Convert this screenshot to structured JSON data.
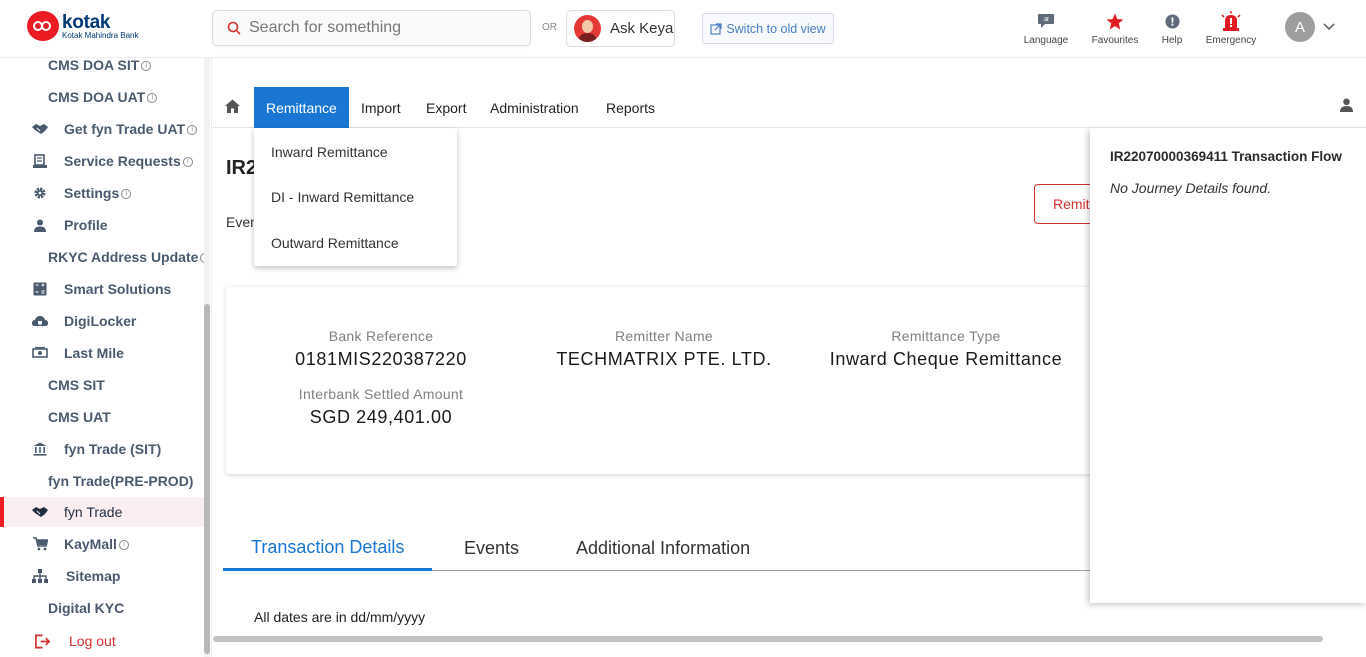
{
  "brand": {
    "name": "kotak",
    "subname": "Kotak Mahindra Bank",
    "color": "#ed1c24",
    "navy": "#003874"
  },
  "search": {
    "placeholder": "Search for something"
  },
  "or_label": "OR",
  "ask_keya": {
    "label": "Ask Keya"
  },
  "switch_view": {
    "label": "Switch to old view"
  },
  "utilities": [
    {
      "label": "Language",
      "icon": "language-icon"
    },
    {
      "label": "Favourites",
      "icon": "star-icon"
    },
    {
      "label": "Help",
      "icon": "help-icon"
    },
    {
      "label": "Emergency",
      "icon": "emergency-icon"
    }
  ],
  "user": {
    "initial": "A"
  },
  "sidebar": {
    "items": [
      {
        "label": "CMS DOA SIT",
        "icon": "",
        "info": true
      },
      {
        "label": "CMS DOA UAT",
        "icon": "",
        "info": true
      },
      {
        "label": "Get fyn Trade UAT",
        "icon": "handshake-icon",
        "info": true
      },
      {
        "label": "Service Requests",
        "icon": "document-icon",
        "info": true
      },
      {
        "label": "Settings",
        "icon": "gear-icon",
        "info": true
      },
      {
        "label": "Profile",
        "icon": "person-icon",
        "info": false
      },
      {
        "label": "RKYC Address Update",
        "icon": "",
        "info": true
      },
      {
        "label": "Smart Solutions",
        "icon": "calculator-icon",
        "info": false
      },
      {
        "label": "DigiLocker",
        "icon": "cloud-lock-icon",
        "info": false
      },
      {
        "label": "Last Mile",
        "icon": "cash-icon",
        "info": false
      },
      {
        "label": "CMS SIT",
        "icon": "",
        "info": false
      },
      {
        "label": "CMS UAT",
        "icon": "",
        "info": false
      },
      {
        "label": "fyn Trade (SIT)",
        "icon": "bank-icon",
        "info": false
      },
      {
        "label": "fyn Trade(PRE-PROD)",
        "icon": "",
        "info": false
      },
      {
        "label": "fyn Trade",
        "icon": "handshake-icon",
        "info": false,
        "active": true
      },
      {
        "label": "KayMall",
        "icon": "cart-icon",
        "info": true
      },
      {
        "label": "Sitemap",
        "icon": "sitemap-icon",
        "info": false
      },
      {
        "label": "Digital KYC",
        "icon": "",
        "info": false
      },
      {
        "label": "Log out",
        "icon": "logout-icon",
        "info": false
      }
    ],
    "accent": "#ed1c24"
  },
  "nav": {
    "items": [
      "Remittance",
      "Import",
      "Export",
      "Administration",
      "Reports"
    ],
    "active_color": "#1976d2"
  },
  "remittance_menu": [
    "Inward Remittance",
    "DI - Inward Remittance",
    "Outward Remittance"
  ],
  "page": {
    "title_visible": "IR2",
    "events_label": "Even",
    "remit_button": "Remit"
  },
  "summary": {
    "bank_reference": {
      "label": "Bank Reference",
      "value": "0181MIS220387220"
    },
    "remitter_name": {
      "label": "Remitter Name",
      "value": "TECHMATRIX PTE. LTD."
    },
    "remittance_type": {
      "label": "Remittance Type",
      "value": "Inward Cheque Remittance"
    },
    "interbank_amount": {
      "label": "Interbank Settled Amount",
      "value": "SGD 249,401.00"
    }
  },
  "tabs": [
    "Transaction Details",
    "Events",
    "Additional Information"
  ],
  "dates_note": "All dates are in dd/mm/yyyy",
  "flow_panel": {
    "title": "IR22070000369411 Transaction Flow",
    "empty_text": "No Journey Details found."
  }
}
